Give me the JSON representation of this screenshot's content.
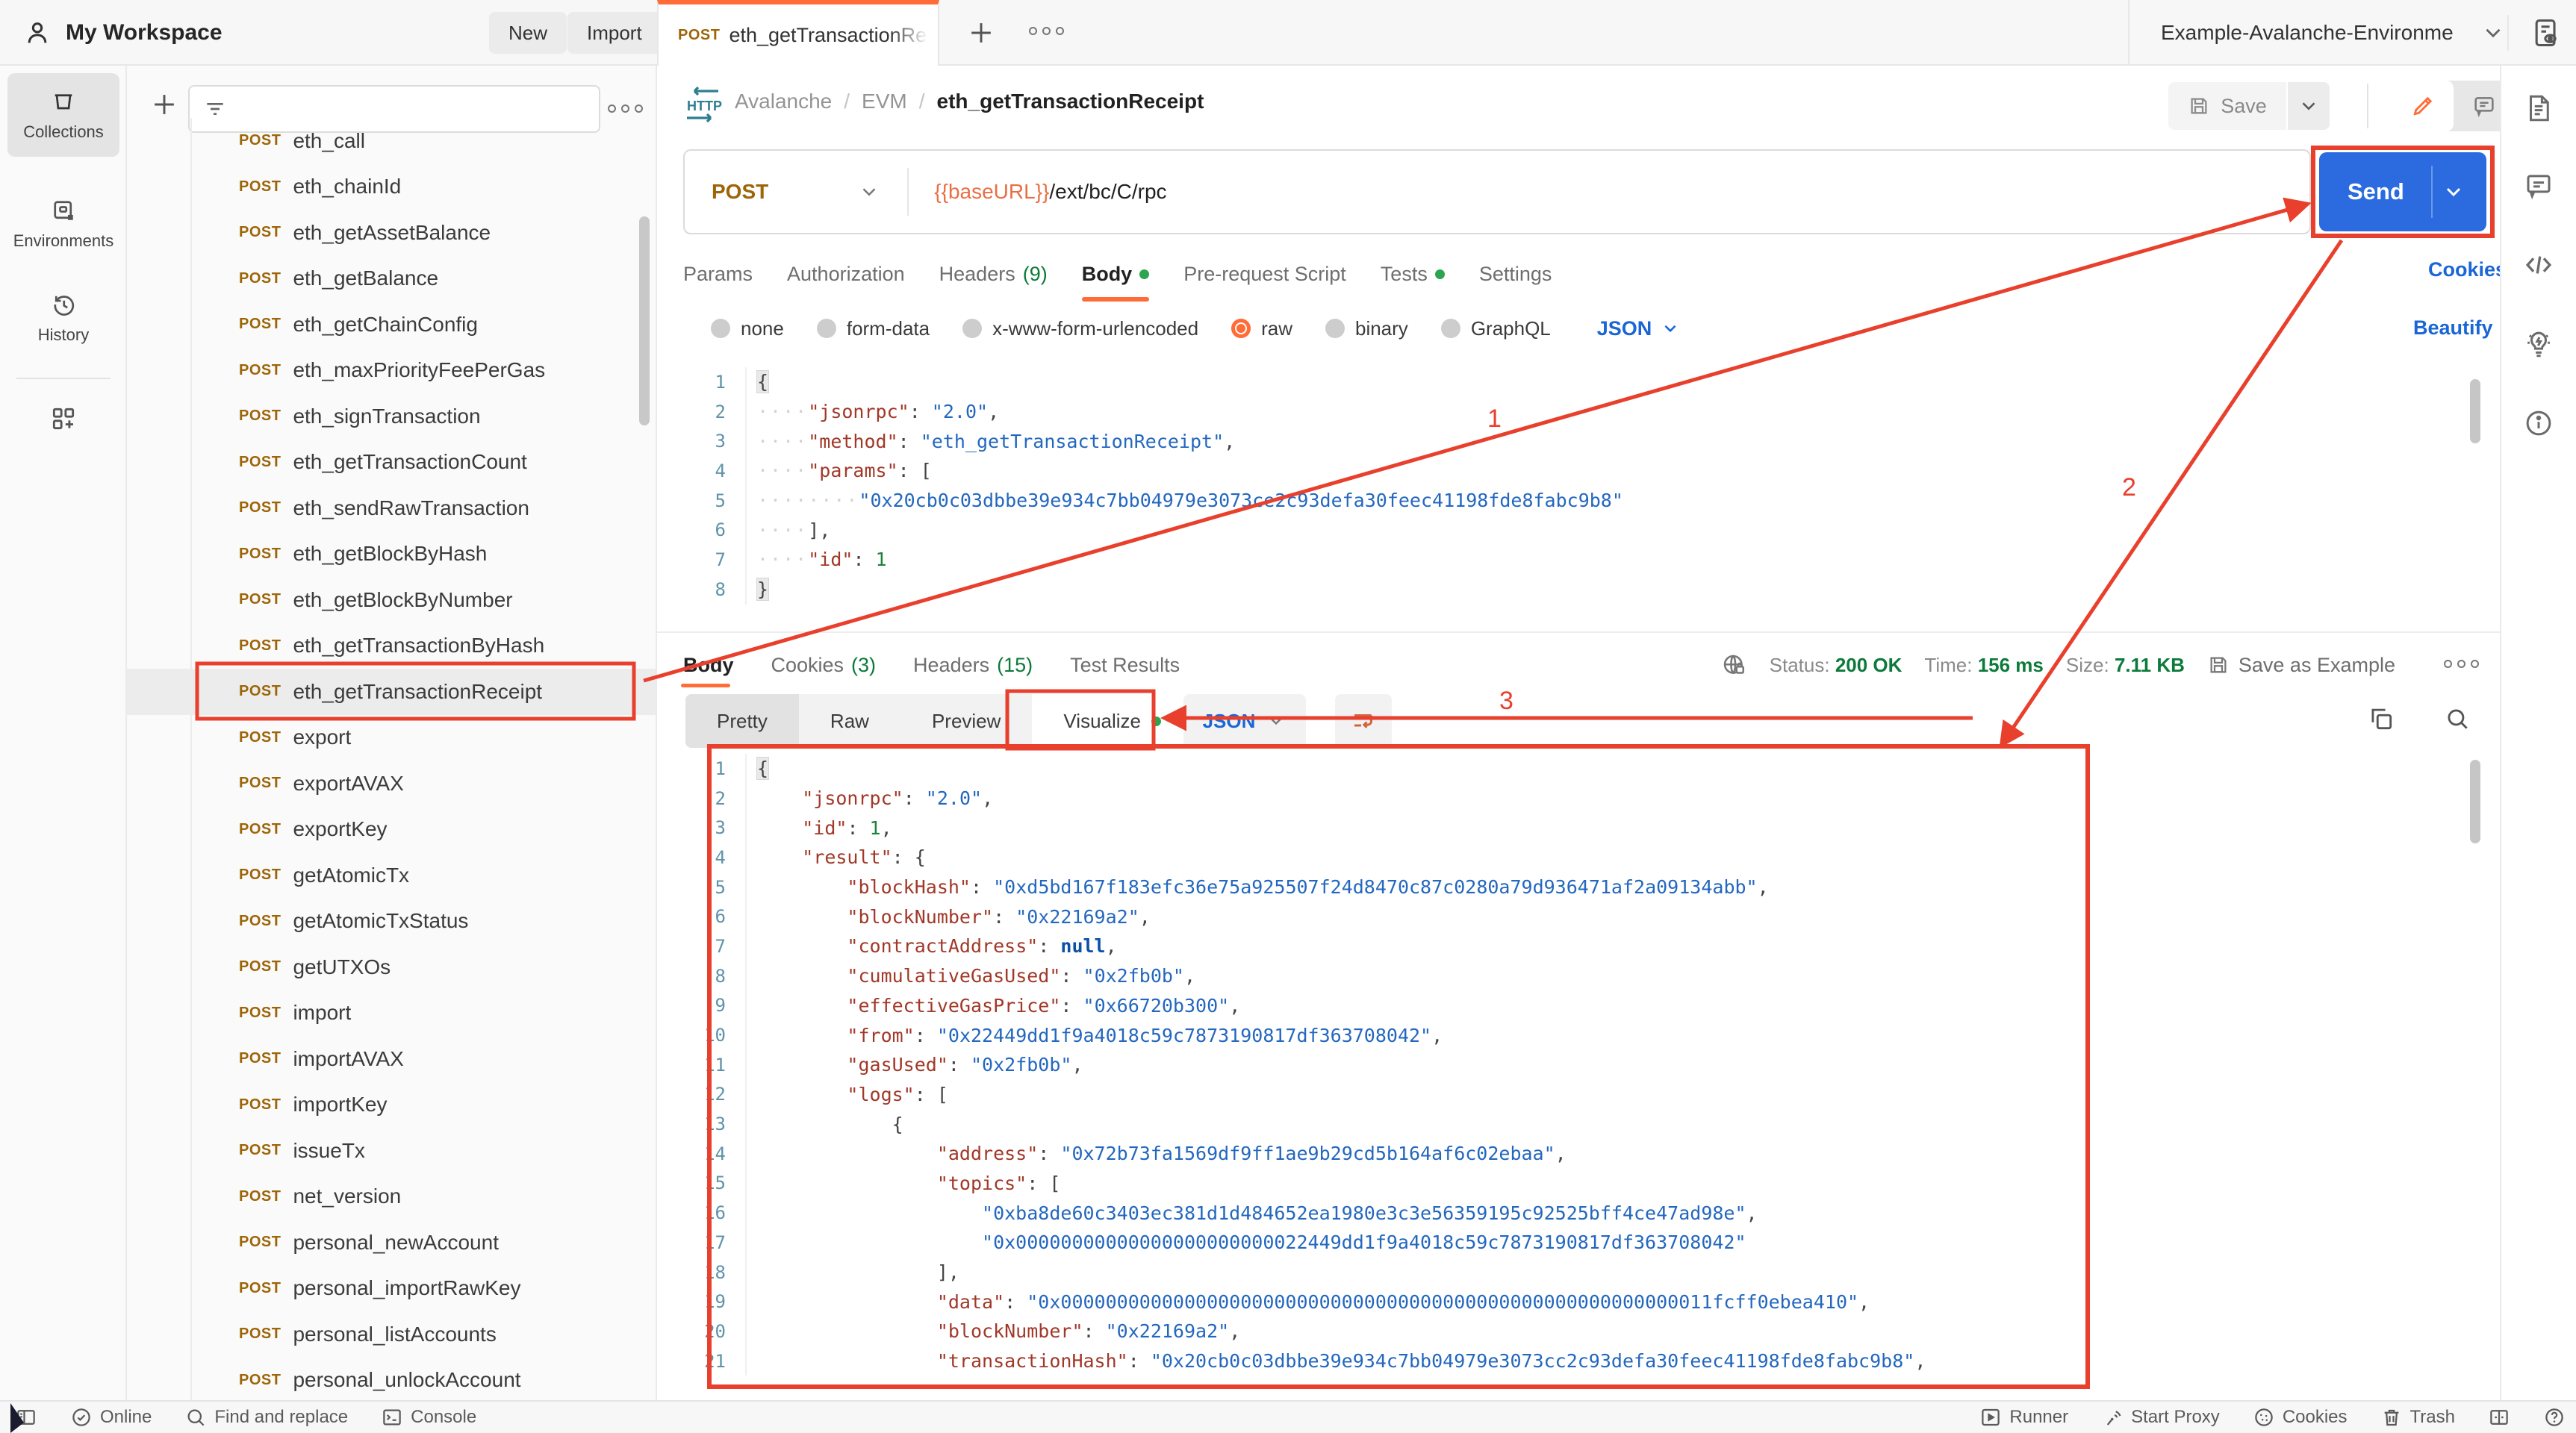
{
  "colors": {
    "accent": "#FF6C37",
    "send_blue": "#2B6BDF",
    "link_blue": "#1A66D6",
    "status_green": "#0C7A3A",
    "method_amber": "#9D6508",
    "annotation_red": "#E8402D"
  },
  "topbar": {
    "workspace": "My Workspace",
    "new_button": "New",
    "import_button": "Import",
    "tab": {
      "method": "POST",
      "name": "eth_getTransactionRece"
    },
    "environment": "Example-Avalanche-Environme"
  },
  "breadcrumb": {
    "collection": "Avalanche",
    "folder": "EVM",
    "request": "eth_getTransactionReceipt",
    "protocol": "HTTP",
    "save_label": "Save"
  },
  "left_rail": {
    "items": [
      {
        "label": "Collections",
        "active": true
      },
      {
        "label": "Environments",
        "active": false
      },
      {
        "label": "History",
        "active": false
      }
    ]
  },
  "sidebar": {
    "items": [
      {
        "method": "POST",
        "name": "eth_call"
      },
      {
        "method": "POST",
        "name": "eth_chainId"
      },
      {
        "method": "POST",
        "name": "eth_getAssetBalance"
      },
      {
        "method": "POST",
        "name": "eth_getBalance"
      },
      {
        "method": "POST",
        "name": "eth_getChainConfig"
      },
      {
        "method": "POST",
        "name": "eth_maxPriorityFeePerGas"
      },
      {
        "method": "POST",
        "name": "eth_signTransaction"
      },
      {
        "method": "POST",
        "name": "eth_getTransactionCount"
      },
      {
        "method": "POST",
        "name": "eth_sendRawTransaction"
      },
      {
        "method": "POST",
        "name": "eth_getBlockByHash"
      },
      {
        "method": "POST",
        "name": "eth_getBlockByNumber"
      },
      {
        "method": "POST",
        "name": "eth_getTransactionByHash"
      },
      {
        "method": "POST",
        "name": "eth_getTransactionReceipt",
        "selected": true
      },
      {
        "method": "POST",
        "name": "export"
      },
      {
        "method": "POST",
        "name": "exportAVAX"
      },
      {
        "method": "POST",
        "name": "exportKey"
      },
      {
        "method": "POST",
        "name": "getAtomicTx"
      },
      {
        "method": "POST",
        "name": "getAtomicTxStatus"
      },
      {
        "method": "POST",
        "name": "getUTXOs"
      },
      {
        "method": "POST",
        "name": "import"
      },
      {
        "method": "POST",
        "name": "importAVAX"
      },
      {
        "method": "POST",
        "name": "importKey"
      },
      {
        "method": "POST",
        "name": "issueTx"
      },
      {
        "method": "POST",
        "name": "net_version"
      },
      {
        "method": "POST",
        "name": "personal_newAccount"
      },
      {
        "method": "POST",
        "name": "personal_importRawKey"
      },
      {
        "method": "POST",
        "name": "personal_listAccounts"
      },
      {
        "method": "POST",
        "name": "personal_unlockAccount"
      }
    ]
  },
  "request": {
    "method": "POST",
    "url_variable": "{{baseURL}}",
    "url_path": "/ext/bc/C/rpc",
    "send_label": "Send",
    "tabs": [
      {
        "label": "Params"
      },
      {
        "label": "Authorization"
      },
      {
        "label": "Headers",
        "count": "(9)"
      },
      {
        "label": "Body",
        "dot": true,
        "active": true
      },
      {
        "label": "Pre-request Script"
      },
      {
        "label": "Tests",
        "dot": true
      },
      {
        "label": "Settings"
      }
    ],
    "cookies_link": "Cookies",
    "body_modes": [
      {
        "label": "none"
      },
      {
        "label": "form-data"
      },
      {
        "label": "x-www-form-urlencoded"
      },
      {
        "label": "raw",
        "selected": true
      },
      {
        "label": "binary"
      },
      {
        "label": "GraphQL"
      }
    ],
    "language": "JSON",
    "beautify_link": "Beautify"
  },
  "request_code": [
    [
      [
        "b",
        "{"
      ]
    ],
    [
      [
        "d",
        "····"
      ],
      [
        "k",
        "\"jsonrpc\""
      ],
      [
        "p",
        ": "
      ],
      [
        "s",
        "\"2.0\""
      ],
      [
        "p",
        ","
      ]
    ],
    [
      [
        "d",
        "····"
      ],
      [
        "k",
        "\"method\""
      ],
      [
        "p",
        ": "
      ],
      [
        "s",
        "\"eth_getTransactionReceipt\""
      ],
      [
        "p",
        ","
      ]
    ],
    [
      [
        "d",
        "····"
      ],
      [
        "k",
        "\"params\""
      ],
      [
        "p",
        ": ["
      ]
    ],
    [
      [
        "d",
        "········"
      ],
      [
        "s",
        "\"0x20cb0c03dbbe39e934c7bb04979e3073ce2c93defa30feec41198fde8fabc9b8\""
      ]
    ],
    [
      [
        "d",
        "····"
      ],
      [
        "p",
        "],"
      ]
    ],
    [
      [
        "d",
        "····"
      ],
      [
        "k",
        "\"id\""
      ],
      [
        "p",
        ": "
      ],
      [
        "n",
        "1"
      ]
    ],
    [
      [
        "b",
        "}"
      ]
    ]
  ],
  "response": {
    "tabs": [
      {
        "label": "Body",
        "active": true
      },
      {
        "label": "Cookies",
        "count": "(3)"
      },
      {
        "label": "Headers",
        "count": "(15)"
      },
      {
        "label": "Test Results"
      }
    ],
    "status_label": "Status:",
    "status_value": "200 OK",
    "time_label": "Time:",
    "time_value": "156 ms",
    "size_label": "Size:",
    "size_value": "7.11 KB",
    "save_as_example": "Save as Example",
    "views": [
      {
        "label": "Pretty",
        "active": true
      },
      {
        "label": "Raw"
      },
      {
        "label": "Preview"
      },
      {
        "label": "Visualize",
        "dot": true,
        "white": true
      }
    ],
    "language": "JSON"
  },
  "response_code": [
    [
      [
        "b",
        "{"
      ]
    ],
    [
      [
        "p",
        "    "
      ],
      [
        "k",
        "\"jsonrpc\""
      ],
      [
        "p",
        ": "
      ],
      [
        "s",
        "\"2.0\""
      ],
      [
        "p",
        ","
      ]
    ],
    [
      [
        "p",
        "    "
      ],
      [
        "k",
        "\"id\""
      ],
      [
        "p",
        ": "
      ],
      [
        "n",
        "1"
      ],
      [
        "p",
        ","
      ]
    ],
    [
      [
        "p",
        "    "
      ],
      [
        "k",
        "\"result\""
      ],
      [
        "p",
        ": {"
      ]
    ],
    [
      [
        "p",
        "        "
      ],
      [
        "k",
        "\"blockHash\""
      ],
      [
        "p",
        ": "
      ],
      [
        "s",
        "\"0xd5bd167f183efc36e75a925507f24d8470c87c0280a79d936471af2a09134abb\""
      ],
      [
        "p",
        ","
      ]
    ],
    [
      [
        "p",
        "        "
      ],
      [
        "k",
        "\"blockNumber\""
      ],
      [
        "p",
        ": "
      ],
      [
        "s",
        "\"0x22169a2\""
      ],
      [
        "p",
        ","
      ]
    ],
    [
      [
        "p",
        "        "
      ],
      [
        "k",
        "\"contractAddress\""
      ],
      [
        "p",
        ": "
      ],
      [
        "x",
        "null"
      ],
      [
        "p",
        ","
      ]
    ],
    [
      [
        "p",
        "        "
      ],
      [
        "k",
        "\"cumulativeGasUsed\""
      ],
      [
        "p",
        ": "
      ],
      [
        "s",
        "\"0x2fb0b\""
      ],
      [
        "p",
        ","
      ]
    ],
    [
      [
        "p",
        "        "
      ],
      [
        "k",
        "\"effectiveGasPrice\""
      ],
      [
        "p",
        ": "
      ],
      [
        "s",
        "\"0x66720b300\""
      ],
      [
        "p",
        ","
      ]
    ],
    [
      [
        "p",
        "        "
      ],
      [
        "k",
        "\"from\""
      ],
      [
        "p",
        ": "
      ],
      [
        "s",
        "\"0x22449dd1f9a4018c59c7873190817df363708042\""
      ],
      [
        "p",
        ","
      ]
    ],
    [
      [
        "p",
        "        "
      ],
      [
        "k",
        "\"gasUsed\""
      ],
      [
        "p",
        ": "
      ],
      [
        "s",
        "\"0x2fb0b\""
      ],
      [
        "p",
        ","
      ]
    ],
    [
      [
        "p",
        "        "
      ],
      [
        "k",
        "\"logs\""
      ],
      [
        "p",
        ": ["
      ]
    ],
    [
      [
        "p",
        "            {"
      ]
    ],
    [
      [
        "p",
        "                "
      ],
      [
        "k",
        "\"address\""
      ],
      [
        "p",
        ": "
      ],
      [
        "s",
        "\"0x72b73fa1569df9ff1ae9b29cd5b164af6c02ebaa\""
      ],
      [
        "p",
        ","
      ]
    ],
    [
      [
        "p",
        "                "
      ],
      [
        "k",
        "\"topics\""
      ],
      [
        "p",
        ": ["
      ]
    ],
    [
      [
        "p",
        "                    "
      ],
      [
        "s",
        "\"0xba8de60c3403ec381d1d484652ea1980e3c3e56359195c92525bff4ce47ad98e\""
      ],
      [
        "p",
        ","
      ]
    ],
    [
      [
        "p",
        "                    "
      ],
      [
        "s",
        "\"0x00000000000000000000000022449dd1f9a4018c59c7873190817df363708042\""
      ]
    ],
    [
      [
        "p",
        "                ],"
      ]
    ],
    [
      [
        "p",
        "                "
      ],
      [
        "k",
        "\"data\""
      ],
      [
        "p",
        ": "
      ],
      [
        "s",
        "\"0x0000000000000000000000000000000000000000000000000000000011fcff0ebea410\""
      ],
      [
        "p",
        ","
      ]
    ],
    [
      [
        "p",
        "                "
      ],
      [
        "k",
        "\"blockNumber\""
      ],
      [
        "p",
        ": "
      ],
      [
        "s",
        "\"0x22169a2\""
      ],
      [
        "p",
        ","
      ]
    ],
    [
      [
        "p",
        "                "
      ],
      [
        "k",
        "\"transactionHash\""
      ],
      [
        "p",
        ": "
      ],
      [
        "s",
        "\"0x20cb0c03dbbe39e934c7bb04979e3073cc2c93defa30feec41198fde8fabc9b8\""
      ],
      [
        "p",
        ","
      ]
    ]
  ],
  "statusbar": {
    "online": "Online",
    "find": "Find and replace",
    "console": "Console",
    "runner": "Runner",
    "proxy": "Start Proxy",
    "cookies": "Cookies",
    "trash": "Trash"
  },
  "annotations": {
    "label1": "1",
    "label2": "2",
    "label3": "3"
  }
}
